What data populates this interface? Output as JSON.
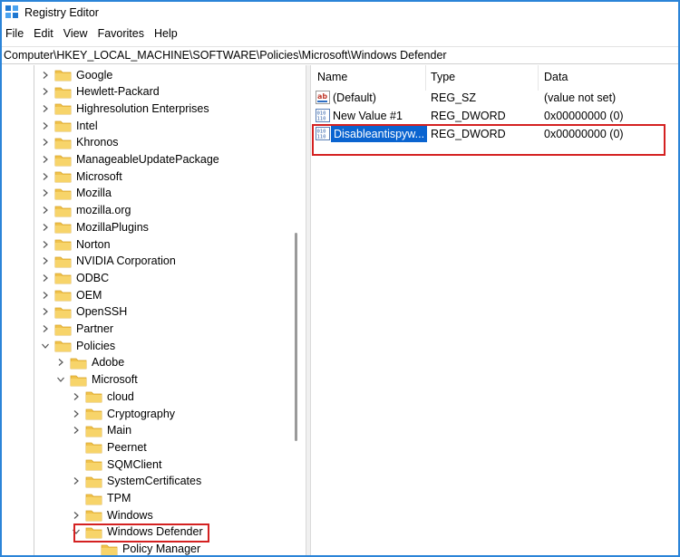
{
  "window": {
    "title": "Registry Editor"
  },
  "menu": [
    "File",
    "Edit",
    "View",
    "Favorites",
    "Help"
  ],
  "address": "Computer\\HKEY_LOCAL_MACHINE\\SOFTWARE\\Policies\\Microsoft\\Windows Defender",
  "tree": {
    "items": [
      {
        "label": "Google",
        "expander": "collapsed"
      },
      {
        "label": "Hewlett-Packard",
        "expander": "collapsed"
      },
      {
        "label": "Highresolution Enterprises",
        "expander": "collapsed"
      },
      {
        "label": "Intel",
        "expander": "collapsed"
      },
      {
        "label": "Khronos",
        "expander": "collapsed"
      },
      {
        "label": "ManageableUpdatePackage",
        "expander": "collapsed"
      },
      {
        "label": "Microsoft",
        "expander": "collapsed"
      },
      {
        "label": "Mozilla",
        "expander": "collapsed"
      },
      {
        "label": "mozilla.org",
        "expander": "collapsed"
      },
      {
        "label": "MozillaPlugins",
        "expander": "collapsed"
      },
      {
        "label": "Norton",
        "expander": "collapsed"
      },
      {
        "label": "NVIDIA Corporation",
        "expander": "collapsed"
      },
      {
        "label": "ODBC",
        "expander": "collapsed"
      },
      {
        "label": "OEM",
        "expander": "collapsed"
      },
      {
        "label": "OpenSSH",
        "expander": "collapsed"
      },
      {
        "label": "Partner",
        "expander": "collapsed"
      },
      {
        "label": "Policies",
        "expander": "expanded"
      },
      {
        "label": "Adobe",
        "expander": "collapsed"
      },
      {
        "label": "Microsoft",
        "expander": "expanded"
      },
      {
        "label": "cloud",
        "expander": "collapsed"
      },
      {
        "label": "Cryptography",
        "expander": "collapsed"
      },
      {
        "label": "Main",
        "expander": "collapsed"
      },
      {
        "label": "Peernet",
        "expander": "none"
      },
      {
        "label": "SQMClient",
        "expander": "none"
      },
      {
        "label": "SystemCertificates",
        "expander": "collapsed"
      },
      {
        "label": "TPM",
        "expander": "none"
      },
      {
        "label": "Windows",
        "expander": "collapsed"
      },
      {
        "label": "Windows Defender",
        "expander": "expanded"
      },
      {
        "label": "Policy Manager",
        "expander": "none"
      }
    ]
  },
  "list": {
    "columns": {
      "name": "Name",
      "type": "Type",
      "data": "Data"
    },
    "rows": [
      {
        "name": "(Default)",
        "type": "REG_SZ",
        "data": "(value not set)",
        "icon": "string-value-icon"
      },
      {
        "name": "New Value #1",
        "type": "REG_DWORD",
        "data": "0x00000000 (0)",
        "icon": "binary-value-icon"
      },
      {
        "name": "Disableantispyw...",
        "type": "REG_DWORD",
        "data": "0x00000000 (0)",
        "icon": "binary-value-icon"
      }
    ]
  },
  "colors": {
    "window_border": "#2b84d8",
    "folder": "#f2c94c",
    "highlight": "#0a64d0",
    "annotation": "#d42121"
  }
}
